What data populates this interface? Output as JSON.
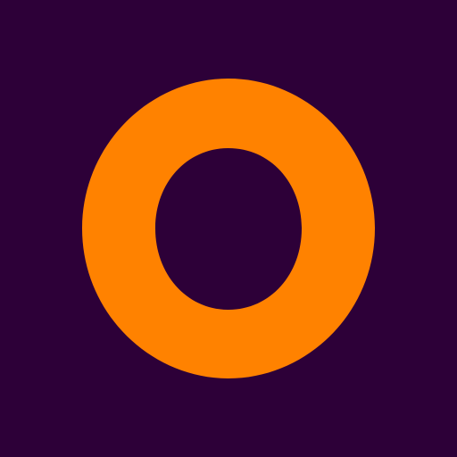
{
  "colors": {
    "background": "#2d0038",
    "ring": "#ff8200"
  },
  "icon": {
    "name": "orange-ring-logo-icon"
  }
}
